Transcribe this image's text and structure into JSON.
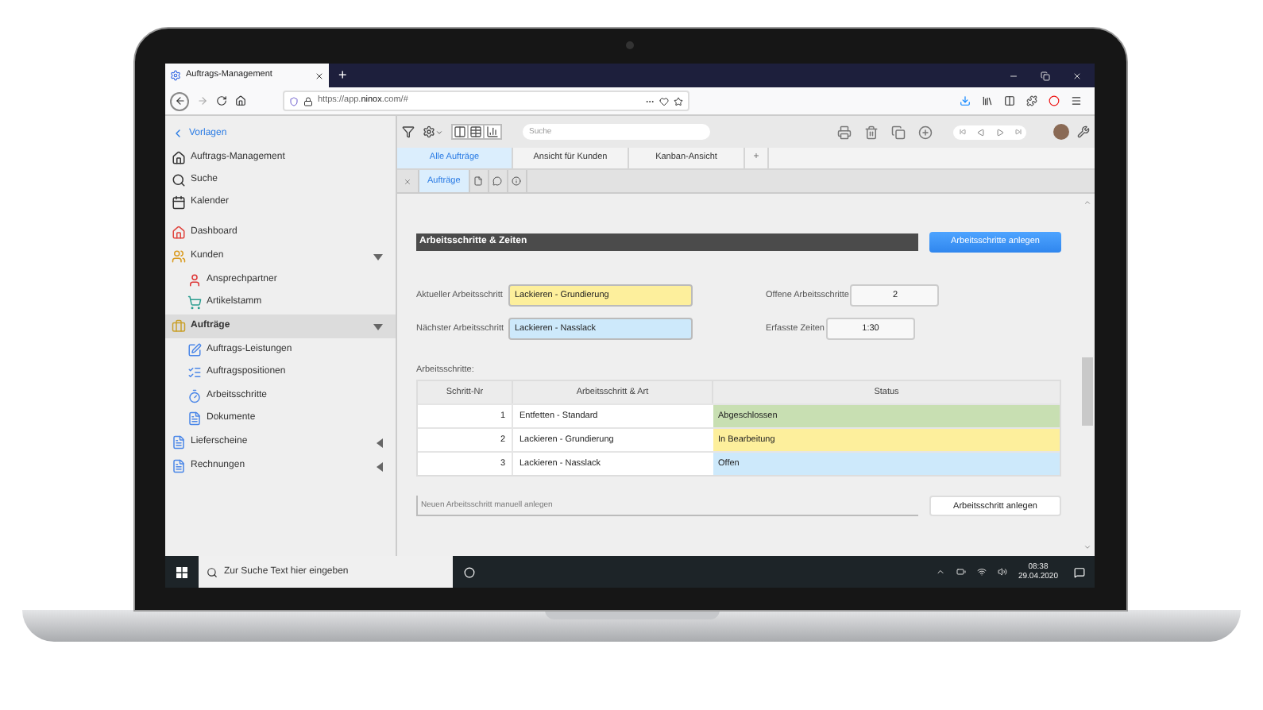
{
  "browser": {
    "tab_title": "Auftrags-Management",
    "new_tab": "+",
    "url": "https://app.**ninox**.com/#"
  },
  "sidebar": {
    "back": "Vorlagen",
    "top_items": [
      "Auftrags-Management",
      "Suche",
      "Kalender"
    ],
    "modules": [
      {
        "label": "Dashboard",
        "selected": false
      },
      {
        "label": "Kunden",
        "selected": false,
        "expanded": true,
        "children": [
          {
            "label": "Ansprechpartner"
          },
          {
            "label": "Artikelstamm"
          }
        ]
      },
      {
        "label": "Aufträge",
        "selected": true,
        "expanded": true,
        "children": [
          {
            "label": "Auftrags-Leistungen"
          },
          {
            "label": "Auftragspositionen"
          },
          {
            "label": "Arbeitsschritte"
          },
          {
            "label": "Dokumente"
          }
        ]
      },
      {
        "label": "Lieferscheine",
        "selected": false,
        "expanded": false
      },
      {
        "label": "Rechnungen",
        "selected": false,
        "expanded": false
      }
    ]
  },
  "toolbar": {
    "search_placeholder": "Suche"
  },
  "view_tabs": [
    {
      "label": "Alle Aufträge",
      "selected": true
    },
    {
      "label": "Ansicht für Kunden",
      "selected": false
    },
    {
      "label": "Kanban-Ansicht",
      "selected": false
    }
  ],
  "add_tab": "+",
  "sub_tabs": [
    {
      "label": "Aufträge",
      "selected": true
    }
  ],
  "section": {
    "title": "Arbeitsschritte & Zeiten",
    "button": "Arbeitsschritte anlegen"
  },
  "fields_left": [
    {
      "label": "Aktueller Arbeitsschritt",
      "value": "Lackieren - Grundierung",
      "color": "#fdef9c"
    },
    {
      "label": "Nächster Arbeitsschritt",
      "value": "Lackieren - Nasslack",
      "color": "#cde9fb"
    }
  ],
  "fields_right": [
    {
      "label": "Offene Arbeitsschritte",
      "value": "2"
    },
    {
      "label": "Erfasste Zeiten",
      "value": "1:30"
    }
  ],
  "table": {
    "caption": "Arbeitsschritte:",
    "columns": [
      "Schritt-Nr",
      "Arbeitsschritt & Art",
      "Status"
    ],
    "rows": [
      {
        "nr": "1",
        "step": "Entfetten - Standard",
        "status": "Abgeschlossen",
        "color": "#c8dfb2"
      },
      {
        "nr": "2",
        "step": "Lackieren - Grundierung",
        "status": "In Bearbeitung",
        "color": "#fdef9c"
      },
      {
        "nr": "3",
        "step": "Lackieren - Nasslack",
        "status": "Offen",
        "color": "#cde9fb"
      }
    ]
  },
  "new_step": {
    "placeholder": "Neuen Arbeitsschritt manuell anlegen",
    "button": "Arbeitsschritt anlegen"
  },
  "taskbar": {
    "search_placeholder": "Zur Suche Text hier eingeben",
    "time": "08:38",
    "date": "29.04.2020"
  }
}
